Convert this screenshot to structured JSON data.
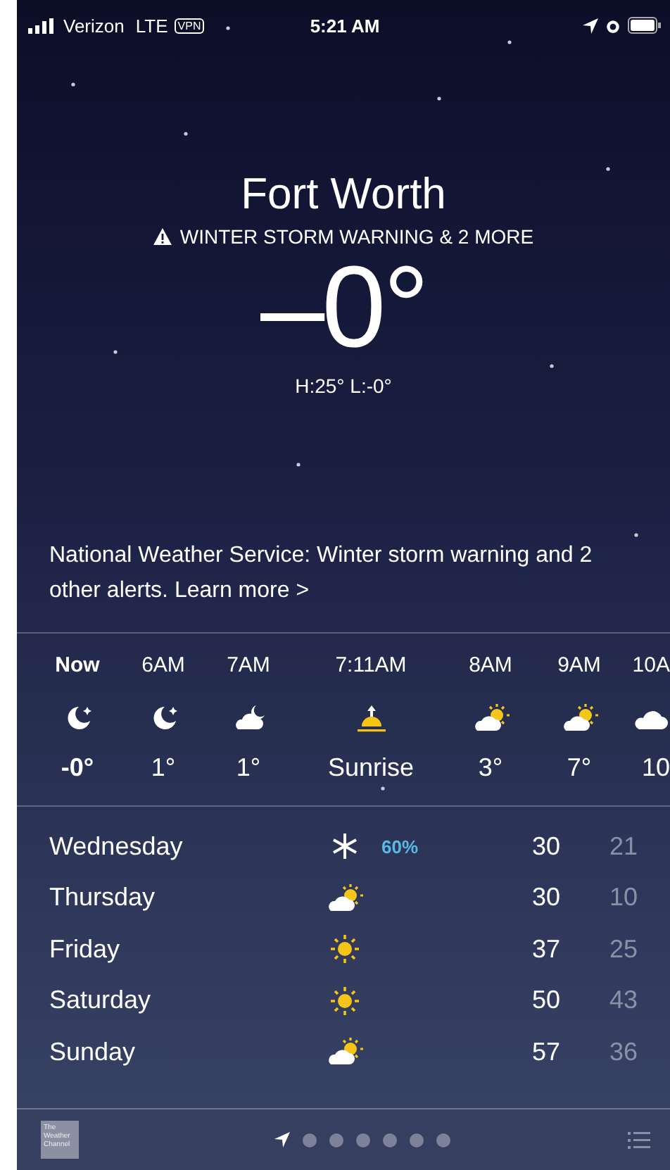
{
  "status_bar": {
    "carrier": "Verizon",
    "network": "LTE",
    "vpn": "VPN",
    "time": "5:21 AM"
  },
  "location": {
    "city": "Fort Worth",
    "alert": "WINTER STORM WARNING & 2 MORE",
    "temperature": "–0°",
    "high_low": "H:25°  L:-0°"
  },
  "notice": {
    "text": "National Weather Service: Winter storm warning and 2 other alerts. ",
    "link": "Learn more >"
  },
  "hourly": [
    {
      "time": "Now",
      "kind": "moon",
      "temp": "-0°",
      "bold": true
    },
    {
      "time": "6AM",
      "kind": "moon",
      "temp": "1°",
      "bold": false
    },
    {
      "time": "7AM",
      "kind": "cloudmoon",
      "temp": "1°",
      "bold": false
    },
    {
      "time": "7:11AM",
      "kind": "sunrise",
      "temp": "Sunrise",
      "bold": false
    },
    {
      "time": "8AM",
      "kind": "cloudsun",
      "temp": "3°",
      "bold": false
    },
    {
      "time": "9AM",
      "kind": "cloudsun",
      "temp": "7°",
      "bold": false
    },
    {
      "time": "10A",
      "kind": "cloud",
      "temp": "10",
      "bold": false
    }
  ],
  "daily": [
    {
      "day": "Wednesday",
      "kind": "snow",
      "precip": "60%",
      "high": "30",
      "low": "21"
    },
    {
      "day": "Thursday",
      "kind": "cloudsun",
      "high": "30",
      "low": "10"
    },
    {
      "day": "Friday",
      "kind": "sun",
      "high": "37",
      "low": "25"
    },
    {
      "day": "Saturday",
      "kind": "sun",
      "high": "50",
      "low": "43"
    },
    {
      "day": "Sunday",
      "kind": "cloudsun",
      "high": "57",
      "low": "36"
    }
  ],
  "footer": {
    "logo": "The Weather Channel",
    "pages": [
      {
        "kind": "location",
        "selected": true
      },
      {
        "kind": "dot",
        "selected": false
      },
      {
        "kind": "dot",
        "selected": false
      },
      {
        "kind": "dot",
        "selected": false
      },
      {
        "kind": "dot",
        "selected": false
      },
      {
        "kind": "dot",
        "selected": false
      },
      {
        "kind": "dot",
        "selected": false
      }
    ]
  }
}
